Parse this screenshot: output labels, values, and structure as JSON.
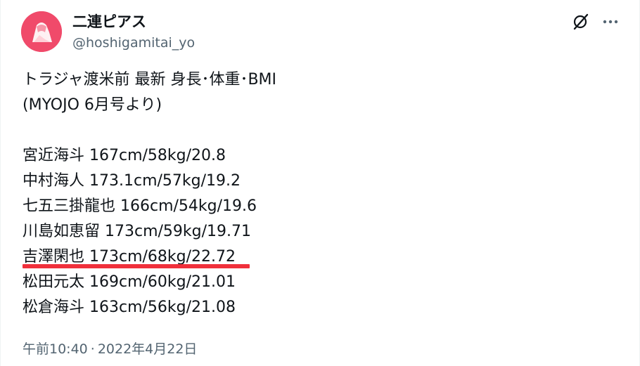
{
  "author": {
    "name": "二連ピアス",
    "handle": "@hoshigamitai_yo",
    "avatar_color": "#f04a6a"
  },
  "actions": {
    "grok_icon": "grok-slash-icon",
    "more_icon": "more-dots-icon"
  },
  "tweet": {
    "title": "トラジャ渡米前 最新 身長･体重･BMI",
    "source": "(MYOJO 6月号より)",
    "members": [
      {
        "text": "宮近海斗 167cm/58kg/20.8"
      },
      {
        "text": "中村海人 173.1cm/57kg/19.2"
      },
      {
        "text": "七五三掛龍也 166cm/54kg/19.6"
      },
      {
        "text": "川島如恵留 173cm/59kg/19.71"
      },
      {
        "text": "吉澤閑也 173cm/68kg/22.72"
      },
      {
        "text": "松田元太 169cm/60kg/21.01"
      },
      {
        "text": "松倉海斗 163cm/56kg/21.08"
      }
    ],
    "highlight_color": "#f0303b"
  },
  "meta": {
    "time": "午前10:40",
    "separator": "·",
    "date": "2022年4月22日"
  }
}
